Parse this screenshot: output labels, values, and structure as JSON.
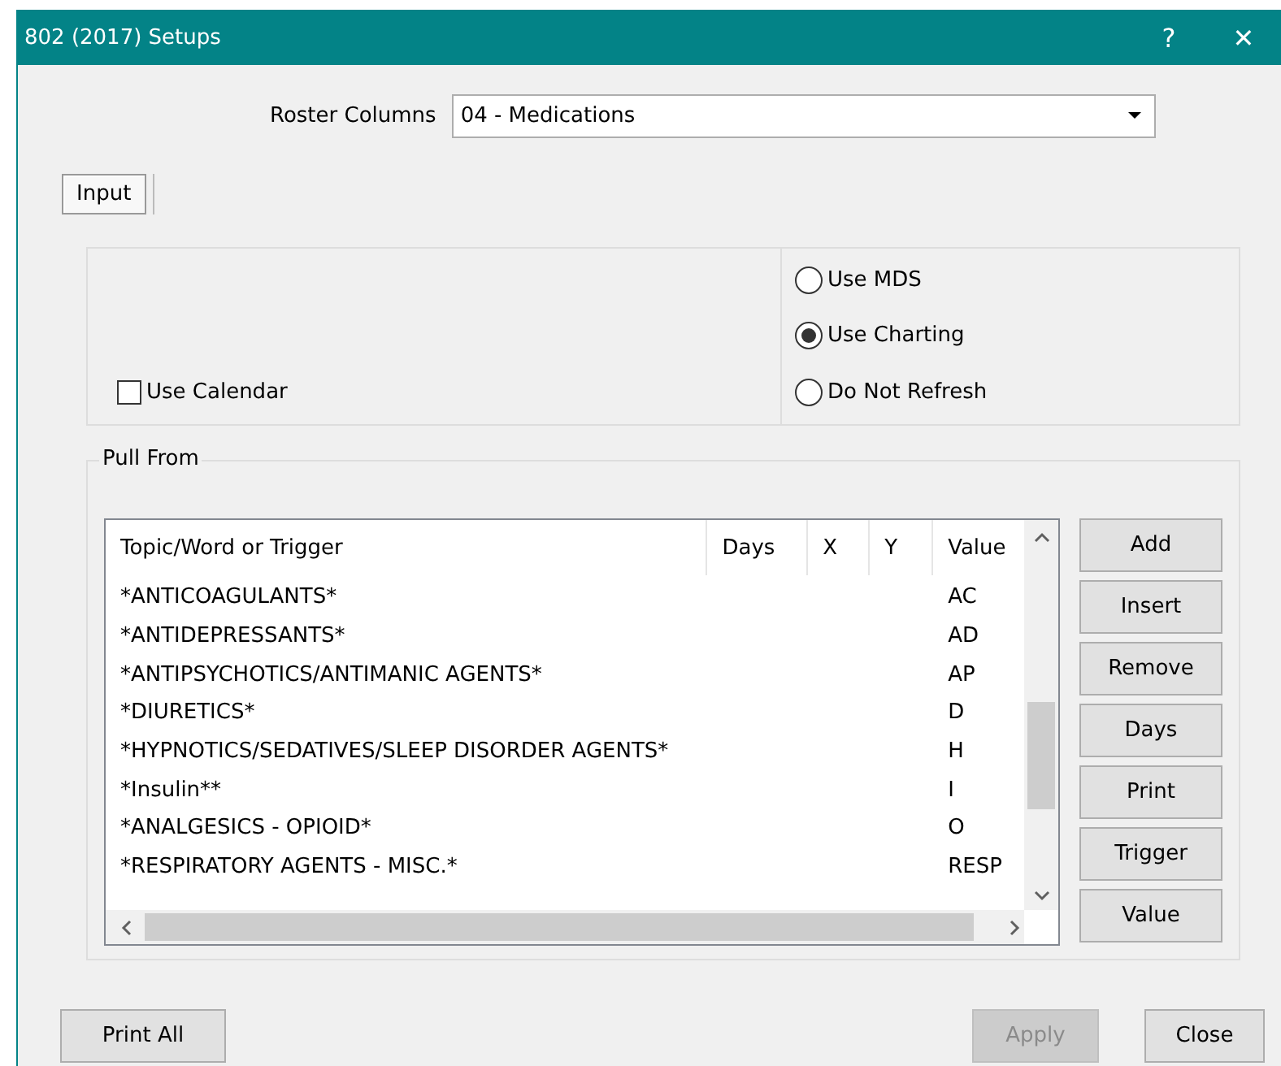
{
  "window": {
    "title": "802 (2017) Setups",
    "help": "?",
    "close": "✕"
  },
  "roster_columns": {
    "label": "Roster Columns",
    "value": "04 - Medications"
  },
  "tabs": [
    {
      "label": "Input",
      "selected": true
    }
  ],
  "use_calendar": {
    "label": "Use Calendar",
    "checked": false
  },
  "refresh_options": [
    {
      "label": "Use MDS",
      "selected": false
    },
    {
      "label": "Use Charting",
      "selected": true
    },
    {
      "label": "Do Not Refresh",
      "selected": false
    }
  ],
  "pull_from": {
    "title": "Pull From",
    "table": {
      "columns": [
        "Topic/Word or Trigger",
        "Days",
        "X",
        "Y",
        "Value"
      ],
      "rows": [
        [
          "*ANTICOAGULANTS*",
          "",
          "",
          "",
          "AC"
        ],
        [
          "*ANTIDEPRESSANTS*",
          "",
          "",
          "",
          "AD"
        ],
        [
          "*ANTIPSYCHOTICS/ANTIMANIC AGENTS*",
          "",
          "",
          "",
          "AP"
        ],
        [
          "*DIURETICS*",
          "",
          "",
          "",
          "D"
        ],
        [
          "*HYPNOTICS/SEDATIVES/SLEEP DISORDER AGENTS*",
          "",
          "",
          "",
          "H"
        ],
        [
          "*Insulin**",
          "",
          "",
          "",
          "I"
        ],
        [
          "*ANALGESICS - OPIOID*",
          "",
          "",
          "",
          "O"
        ],
        [
          "*RESPIRATORY AGENTS - MISC.*",
          "",
          "",
          "",
          "RESP"
        ]
      ]
    },
    "buttons": [
      "Add",
      "Insert",
      "Remove",
      "Days",
      "Print",
      "Trigger",
      "Value"
    ]
  },
  "footer_buttons": [
    {
      "label": "Print All",
      "disabled": false
    },
    {
      "label": "Apply",
      "disabled": true
    },
    {
      "label": "Close",
      "disabled": false
    }
  ]
}
